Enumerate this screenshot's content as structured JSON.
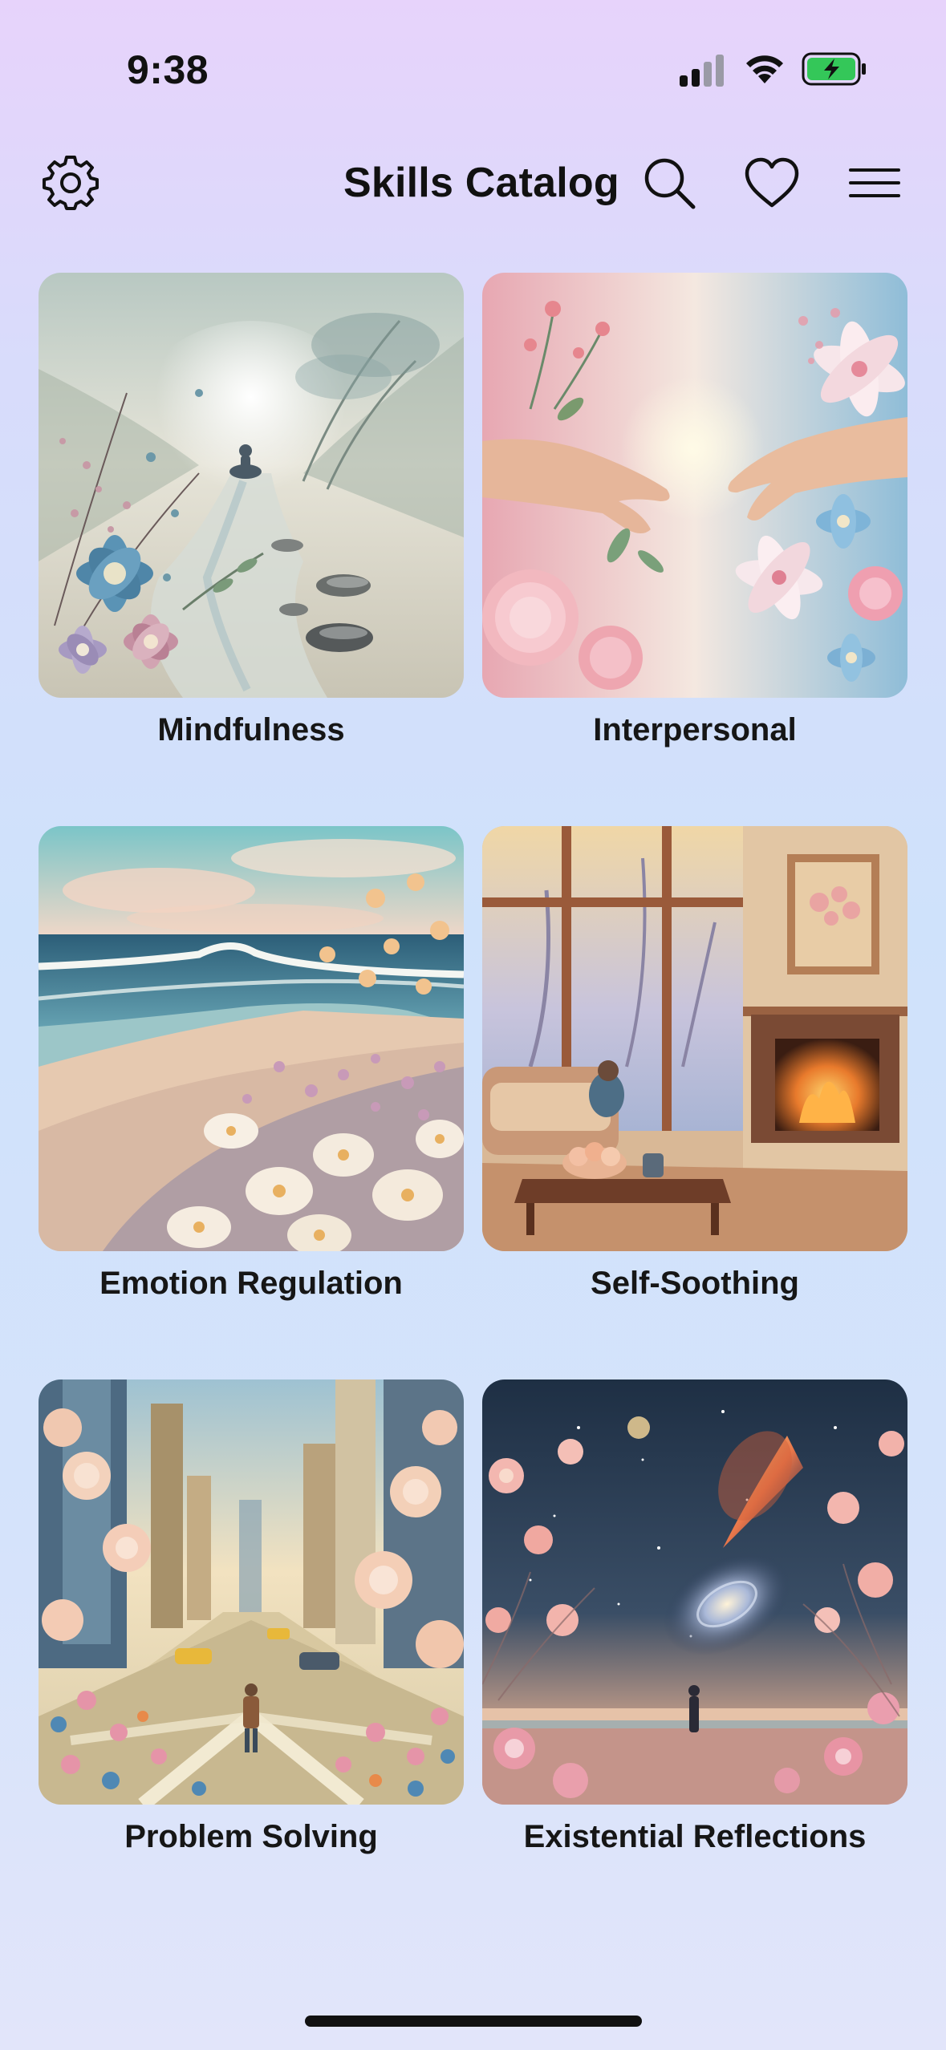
{
  "status_bar": {
    "time": "9:38",
    "signal_icon": "cellular-signal-icon",
    "wifi_icon": "wifi-icon",
    "battery_icon": "battery-charging-icon",
    "battery_color": "#34c759"
  },
  "header": {
    "title": "Skills Catalog",
    "settings_icon": "gear-icon",
    "search_icon": "search-icon",
    "favorites_icon": "heart-icon",
    "menu_icon": "hamburger-menu-icon"
  },
  "categories": [
    {
      "label": "Mindfulness"
    },
    {
      "label": "Interpersonal"
    },
    {
      "label": "Emotion Regulation"
    },
    {
      "label": "Self-Soothing"
    },
    {
      "label": "Problem Solving"
    },
    {
      "label": "Existential Reflections"
    }
  ]
}
